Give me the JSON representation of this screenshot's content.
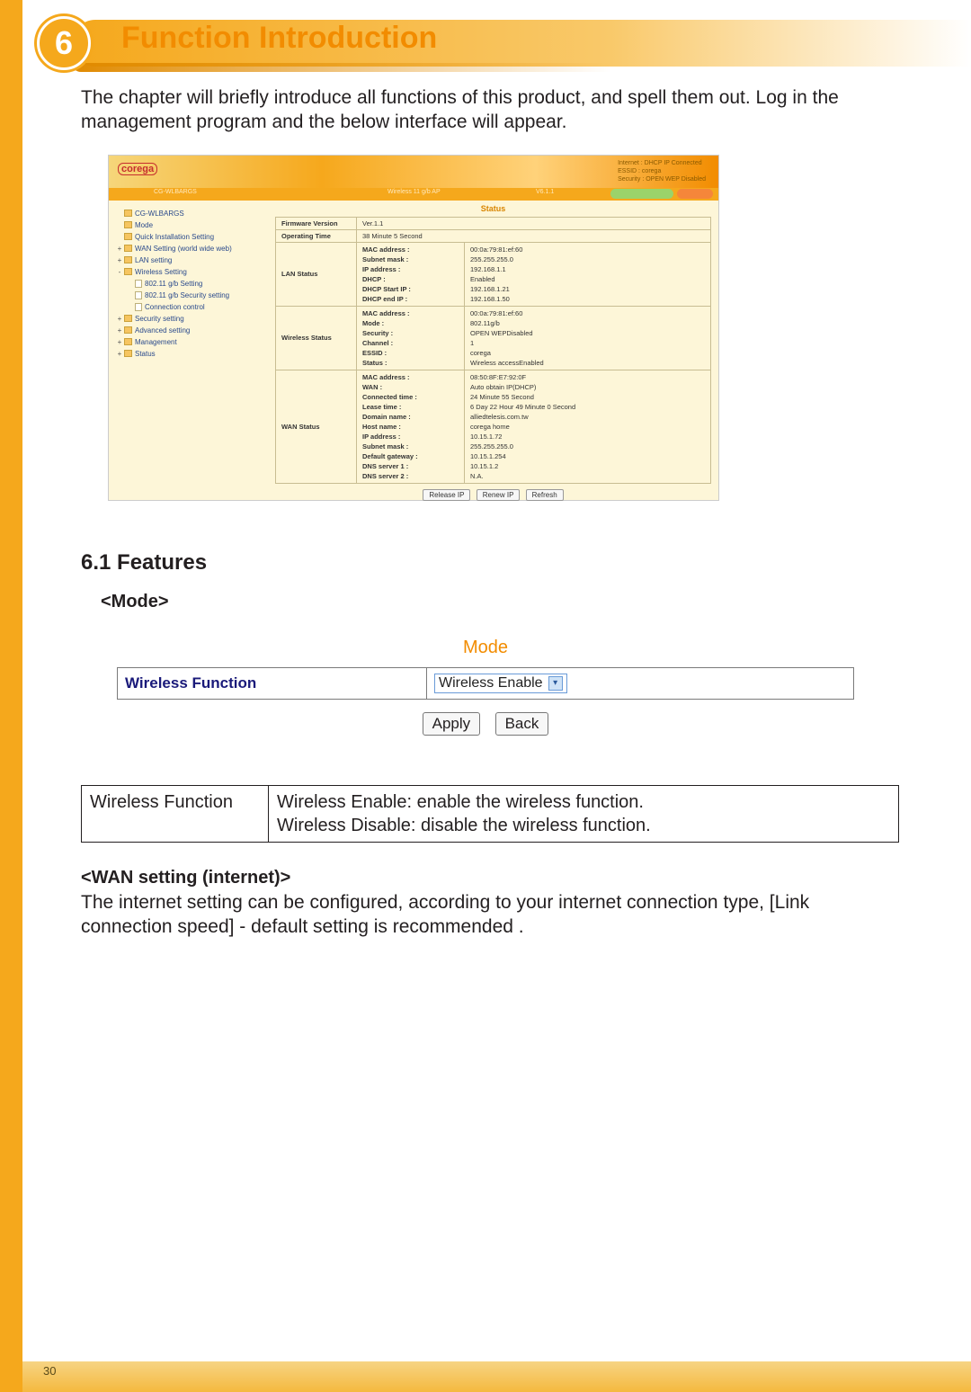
{
  "page": {
    "number": "30"
  },
  "chapter": {
    "num": "6",
    "title": "Function Introduction"
  },
  "intro": "The chapter will briefly introduce all functions of this product, and spell them out.  Log in the management program and the below interface will appear.",
  "section_features": "6.1 Features",
  "mode_heading": "<Mode>",
  "wan_heading": "<WAN setting (internet)>",
  "wan_text": "The internet setting can be configured, according to your internet connection type, [Link connection speed] - default setting is recommended .",
  "mode_panel": {
    "title": "Mode",
    "row_label": "Wireless Function",
    "select_value": "Wireless Enable",
    "apply": "Apply",
    "back": "Back"
  },
  "desc_table": {
    "c1": "Wireless Function",
    "c2a": "Wireless Enable: enable the wireless function.",
    "c2b": "Wireless Disable: disable the wireless function."
  },
  "shot": {
    "logo": "corega",
    "hdr_status": {
      "a": "Internet : DHCP IP Connected",
      "b": "ESSID : corega",
      "c": "Security : OPEN WEP Disabled"
    },
    "bar": {
      "t1": "CG-WLBARGS",
      "t2": "Wireless 11 g/b AP",
      "t3": "V6.1.1"
    },
    "main_title": "Status",
    "nav": [
      {
        "indent": 0,
        "icon": "ic",
        "exp": "",
        "label": "CG-WLBARGS"
      },
      {
        "indent": 0,
        "icon": "ic",
        "exp": "",
        "label": "Mode"
      },
      {
        "indent": 0,
        "icon": "ic",
        "exp": "",
        "label": "Quick Installation Setting"
      },
      {
        "indent": 0,
        "icon": "ic",
        "exp": "+",
        "label": "WAN Setting (world wide web)"
      },
      {
        "indent": 0,
        "icon": "ic",
        "exp": "+",
        "label": "LAN setting"
      },
      {
        "indent": 0,
        "icon": "ic",
        "exp": "-",
        "label": "Wireless Setting"
      },
      {
        "indent": 1,
        "icon": "pg",
        "exp": "",
        "label": "802.11 g/b Setting"
      },
      {
        "indent": 1,
        "icon": "pg",
        "exp": "",
        "label": "802.11 g/b Security setting"
      },
      {
        "indent": 1,
        "icon": "pg",
        "exp": "",
        "label": "Connection control"
      },
      {
        "indent": 0,
        "icon": "ic",
        "exp": "+",
        "label": "Security setting"
      },
      {
        "indent": 0,
        "icon": "ic",
        "exp": "+",
        "label": "Advanced setting"
      },
      {
        "indent": 0,
        "icon": "ic",
        "exp": "+",
        "label": "Management"
      },
      {
        "indent": 0,
        "icon": "ic",
        "exp": "+",
        "label": "Status"
      }
    ],
    "rows": [
      {
        "label": "Firmware Version",
        "keys": [],
        "vals_single": "Ver.1.1"
      },
      {
        "label": "Operating Time",
        "keys": [],
        "vals_single": "38 Minute 5 Second"
      },
      {
        "label": "LAN Status",
        "keys": [
          "MAC address :",
          "Subnet mask :",
          "IP address :",
          "DHCP :",
          "DHCP Start IP :",
          "DHCP end IP :"
        ],
        "vals": [
          "00:0a:79:81:ef:60",
          "255.255.255.0",
          "192.168.1.1",
          "Enabled",
          "192.168.1.21",
          "192.168.1.50"
        ]
      },
      {
        "label": "Wireless Status",
        "keys": [
          "MAC address :",
          "Mode :",
          "Security :",
          "Channel :",
          "ESSID :",
          "Status :"
        ],
        "vals": [
          "00:0a:79:81:ef:60",
          "802.11g/b",
          "OPEN WEPDisabled",
          "1",
          "corega",
          "Wireless accessEnabled"
        ]
      },
      {
        "label": "WAN Status",
        "keys": [
          "MAC address :",
          "WAN :",
          "Connected time :",
          "Lease time :",
          "Domain name :",
          "Host name :",
          "IP address :",
          "Subnet mask :",
          "Default gateway :",
          "DNS server 1 :",
          "DNS server 2 :"
        ],
        "vals": [
          "08:50:8F:E7:92:0F",
          "Auto obtain IP(DHCP)",
          "24 Minute 55 Second",
          "6 Day 22 Hour 49 Minute 0 Second",
          "alliedtelesis.com.tw",
          "corega home",
          "10.15.1.72",
          "255.255.255.0",
          "10.15.1.254",
          "10.15.1.2",
          "N.A."
        ]
      }
    ],
    "buttons": {
      "release": "Release IP",
      "renew": "Renew IP",
      "refresh": "Refresh"
    }
  }
}
